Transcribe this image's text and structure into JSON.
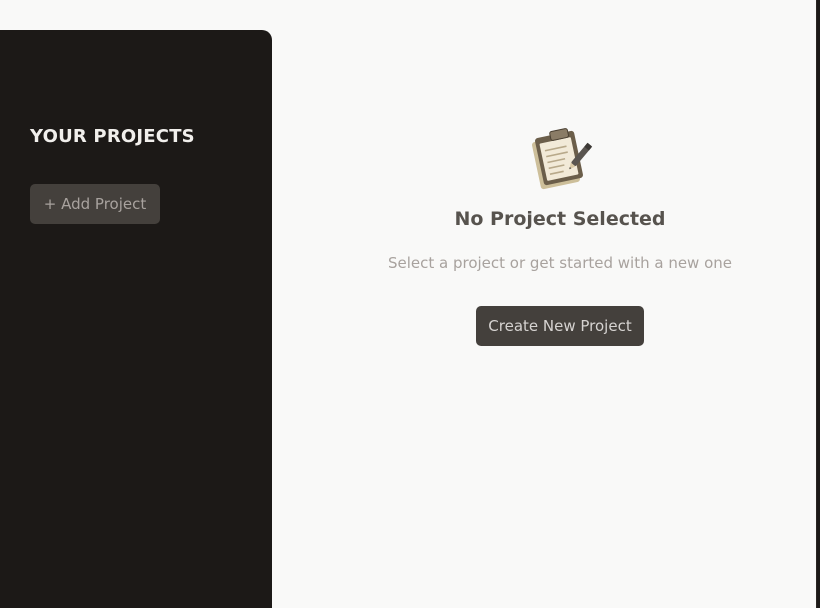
{
  "sidebar": {
    "title": "YOUR PROJECTS",
    "add_button_label": "+ Add Project"
  },
  "main": {
    "icon": "clipboard-icon",
    "title": "No Project Selected",
    "subtitle": "Select a project or get started with a new one",
    "create_button_label": "Create New Project"
  },
  "colors": {
    "sidebar_bg": "#1c1917",
    "button_bg": "#44403c",
    "main_bg": "#f9f9f8",
    "title_text": "#57534e",
    "muted_text": "#a8a29e"
  }
}
